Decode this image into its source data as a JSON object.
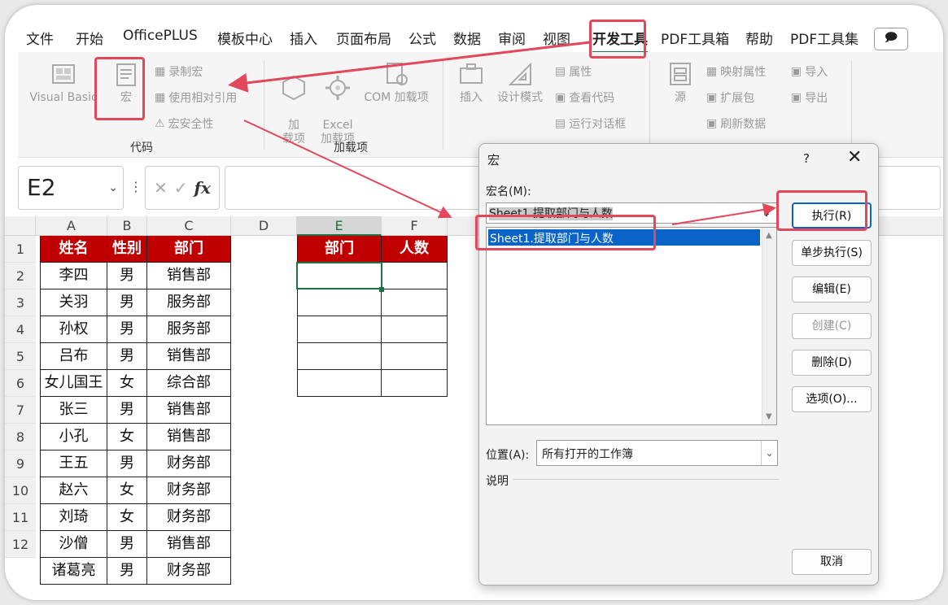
{
  "tabs": [
    "文件",
    "开始",
    "OfficePLUS",
    "模板中心",
    "插入",
    "页面布局",
    "公式",
    "数据",
    "审阅",
    "视图",
    "开发工具",
    "PDF工具箱",
    "帮助",
    "PDF工具集"
  ],
  "active_tab": "开发工具",
  "ribbon": {
    "visual_basic": "Visual Basic",
    "macro": "宏",
    "record_macro": "录制宏",
    "relative_ref": "使用相对引用",
    "macro_security": "宏安全性",
    "group_code": "代码",
    "addins": "加\n载项",
    "excel_addins": "Excel\n加载项",
    "com_addins": "COM 加载项",
    "group_addins": "加载项",
    "insert": "插入",
    "design_mode": "设计模式",
    "properties": "属性",
    "view_code": "查看代码",
    "run_dialog": "运行对话框",
    "source": "源",
    "map_properties": "映射属性",
    "expansion_pack": "扩展包",
    "refresh_data": "刷新数据",
    "import": "导入",
    "export": "导出"
  },
  "formula_bar": {
    "name_box": "E2",
    "fx": "fx",
    "formula": ""
  },
  "columns": [
    "A",
    "B",
    "C",
    "D",
    "E",
    "F"
  ],
  "rows": [
    "1",
    "2",
    "3",
    "4",
    "5",
    "6",
    "7",
    "8",
    "9",
    "10",
    "11",
    "12"
  ],
  "table_main": {
    "headers": [
      "姓名",
      "性别",
      "部门"
    ],
    "rows": [
      [
        "李四",
        "男",
        "销售部"
      ],
      [
        "关羽",
        "男",
        "服务部"
      ],
      [
        "孙权",
        "男",
        "服务部"
      ],
      [
        "吕布",
        "男",
        "销售部"
      ],
      [
        "女儿国王",
        "女",
        "综合部"
      ],
      [
        "张三",
        "男",
        "销售部"
      ],
      [
        "小孔",
        "女",
        "销售部"
      ],
      [
        "王五",
        "男",
        "财务部"
      ],
      [
        "赵六",
        "女",
        "财务部"
      ],
      [
        "刘琦",
        "女",
        "财务部"
      ],
      [
        "沙僧",
        "男",
        "销售部"
      ],
      [
        "诸葛亮",
        "男",
        "财务部"
      ]
    ]
  },
  "table_summary": {
    "headers": [
      "部门",
      "人数"
    ]
  },
  "dialog": {
    "title": "宏",
    "help": "?",
    "close": "✕",
    "macro_name_label": "宏名(M):",
    "macro_name_value": "Sheet1.提取部门与人数",
    "macro_list": [
      "Sheet1.提取部门与人数"
    ],
    "buttons": {
      "run": "执行(R)",
      "step_into": "单步执行(S)",
      "edit": "编辑(E)",
      "create": "创建(C)",
      "delete": "删除(D)",
      "options": "选项(O)..."
    },
    "location_label": "位置(A):",
    "location_value": "所有打开的工作簿",
    "description_label": "说明"
  },
  "colors": {
    "header_fill": "#c00000",
    "accent_green": "#1e7145",
    "highlight_red": "#e5475a",
    "selection_blue": "#0a64c8"
  }
}
